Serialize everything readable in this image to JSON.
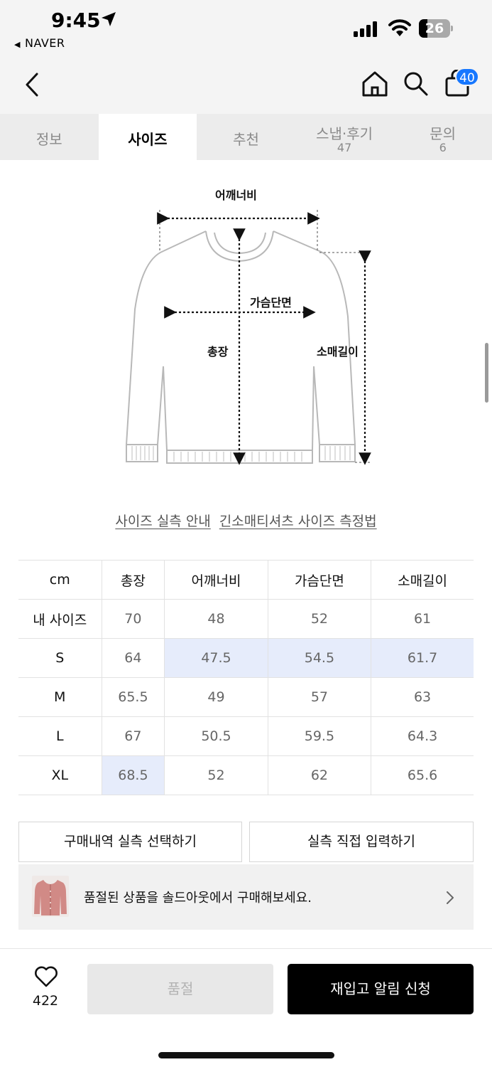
{
  "status_bar": {
    "time": "9:45",
    "back_app": "NAVER",
    "battery": "26"
  },
  "header": {
    "cart_count": "40"
  },
  "tabs": [
    {
      "label": "정보"
    },
    {
      "label": "사이즈"
    },
    {
      "label": "추천"
    },
    {
      "label": "스냅·후기",
      "count": "47"
    },
    {
      "label": "문의",
      "count": "6"
    }
  ],
  "diagram": {
    "shoulder": "어깨너비",
    "chest": "가슴단면",
    "length": "총장",
    "sleeve": "소매길이"
  },
  "links": {
    "guide": "사이즈 실측 안내",
    "method": "긴소매티셔츠 사이즈 측정법"
  },
  "size_table": {
    "headers": [
      "cm",
      "총장",
      "어깨너비",
      "가슴단면",
      "소매길이"
    ],
    "rows": [
      [
        "내 사이즈",
        "70",
        "48",
        "52",
        "61"
      ],
      [
        "S",
        "64",
        "47.5",
        "54.5",
        "61.7"
      ],
      [
        "M",
        "65.5",
        "49",
        "57",
        "63"
      ],
      [
        "L",
        "67",
        "50.5",
        "59.5",
        "64.3"
      ],
      [
        "XL",
        "68.5",
        "52",
        "62",
        "65.6"
      ]
    ]
  },
  "buttons": {
    "history": "구매내역 실측 선택하기",
    "direct": "실측 직접 입력하기"
  },
  "banner": {
    "text": "품절된 상품을 솔드아웃에서 구매해보세요."
  },
  "bottom": {
    "likes": "422",
    "soldout": "품절",
    "restock": "재입고 알림 신청"
  },
  "colors": {
    "highlight": "#e6ecfb",
    "badge": "#1677ff"
  }
}
